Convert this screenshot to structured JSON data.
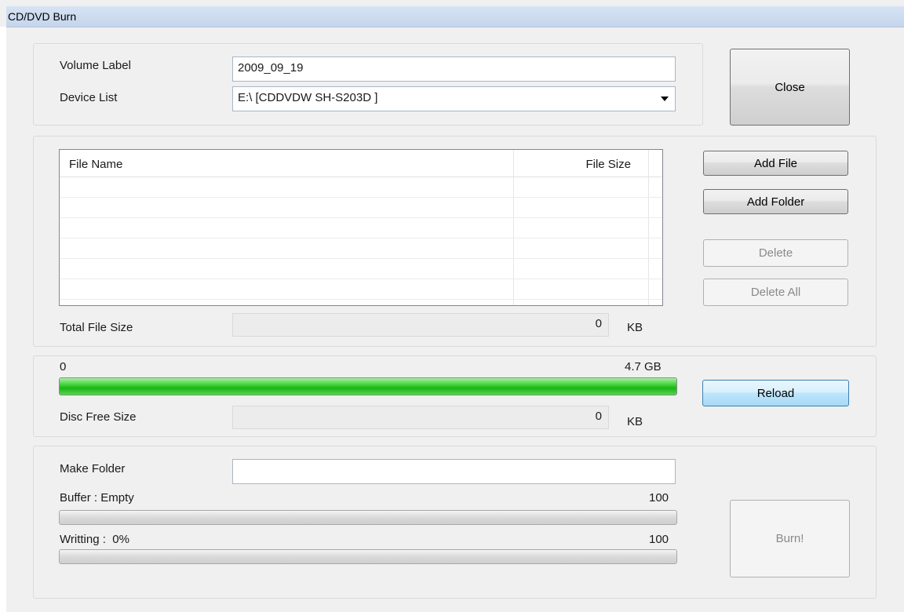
{
  "window": {
    "title": "CD/DVD Burn"
  },
  "volume": {
    "label_text": "Volume Label",
    "value": "2009_09_19",
    "device_label": "Device List",
    "device_selected": "E:\\ [CDDVDW SH-S203D ]"
  },
  "buttons": {
    "close": "Close",
    "add_file": "Add File",
    "add_folder": "Add Folder",
    "delete": "Delete",
    "delete_all": "Delete All",
    "reload": "Reload",
    "burn": "Burn!"
  },
  "file_list": {
    "columns": [
      "File Name",
      "File Size"
    ],
    "rows": []
  },
  "total": {
    "label": "Total File Size",
    "value": "0",
    "unit": "KB"
  },
  "disc": {
    "min_label": "0",
    "max_label": "4.7 GB",
    "usage_fraction": 1.0,
    "free_label": "Disc Free Size",
    "free_value": "0",
    "free_unit": "KB"
  },
  "make_folder": {
    "label": "Make Folder",
    "value": ""
  },
  "buffer": {
    "label": "Buffer :",
    "status": "Empty",
    "max": "100",
    "progress": 0
  },
  "writing": {
    "label": "Writting :",
    "percent": "0%",
    "max": "100",
    "progress": 0
  },
  "colors": {
    "progress_green": "#1fb21a",
    "focus_blue": "#3c7fb1",
    "title_bar": "#c4d5ec"
  }
}
